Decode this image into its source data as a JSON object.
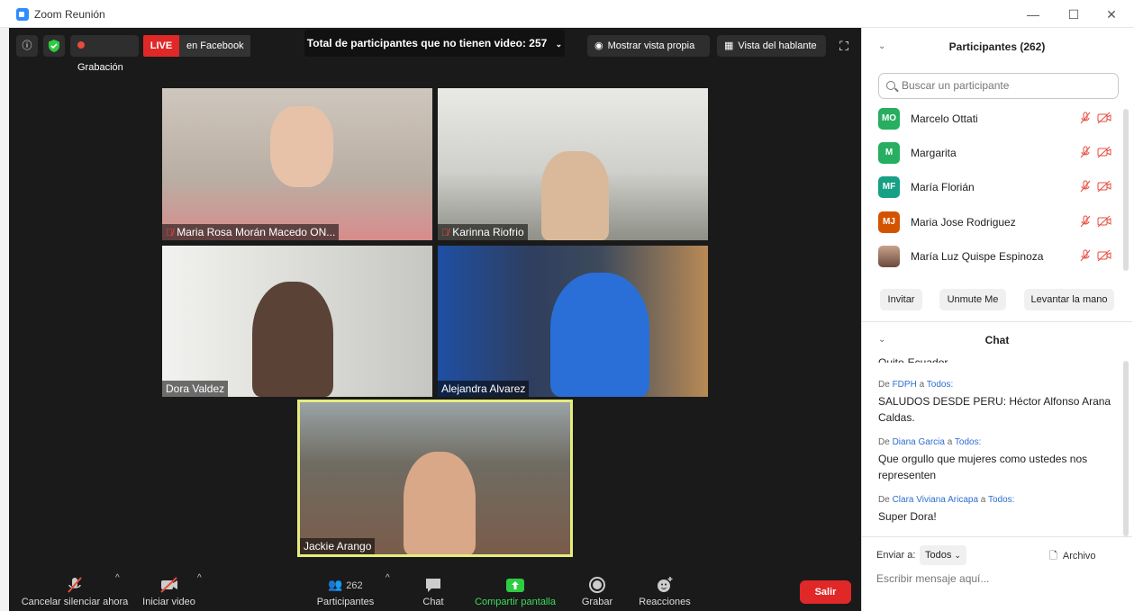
{
  "window": {
    "title": "Zoom Reunión"
  },
  "meeting_top": {
    "recording_label": "Grabación",
    "live_label": "LIVE",
    "facebook_label": "en Facebook",
    "total_no_video": "Total de participantes que no tienen video: 257",
    "show_self_view": "Mostrar vista propia",
    "speaker_view": "Vista del hablante"
  },
  "tiles": [
    {
      "name": "Maria Rosa Morán Macedo ON...",
      "muted": true
    },
    {
      "name": "Karinna Riofrio",
      "muted": true
    },
    {
      "name": "Dora Valdez",
      "muted": false
    },
    {
      "name": "Alejandra Alvarez",
      "muted": false
    },
    {
      "name": "Jackie Arango",
      "muted": false
    }
  ],
  "toolbar": {
    "unmute": "Cancelar silenciar ahora",
    "start_video": "Iniciar video",
    "participants": "Participantes",
    "participants_count": "262",
    "chat": "Chat",
    "share_screen": "Compartir pantalla",
    "record": "Grabar",
    "reactions": "Reacciones",
    "leave": "Salir"
  },
  "participants_panel": {
    "title": "Participantes (262)",
    "search_placeholder": "Buscar un participante",
    "list": [
      {
        "initials": "MO",
        "name": "Marcelo Ottati",
        "color": "#27ae60"
      },
      {
        "initials": "M",
        "name": "Margarita",
        "color": "#27ae60"
      },
      {
        "initials": "MF",
        "name": "María Florián",
        "color": "#16a085"
      },
      {
        "initials": "MJ",
        "name": "Maria Jose Rodriguez",
        "color": "#d35400"
      },
      {
        "initials": "",
        "name": "María Luz Quispe Espinoza",
        "color": "#a08070"
      }
    ],
    "invite": "Invitar",
    "unmute_me": "Unmute Me",
    "raise_hand": "Levantar la mano"
  },
  "chat_panel": {
    "title": "Chat",
    "partial_text": "Quito-Ecuador",
    "messages": [
      {
        "from_prefix": "De",
        "from": "FDPH",
        "to_prefix": "a",
        "to": "Todos:",
        "text": "SALUDOS DESDE PERU: Héctor Alfonso Arana Caldas."
      },
      {
        "from_prefix": "De",
        "from": "Diana Garcia",
        "to_prefix": "a",
        "to": "Todos:",
        "text": "Que orgullo que mujeres como ustedes nos representen"
      },
      {
        "from_prefix": "De",
        "from": "Clara Viviana Aricapa",
        "to_prefix": "a",
        "to": "Todos:",
        "text": "Super Dora!"
      }
    ],
    "send_to_label": "Enviar a:",
    "send_to_value": "Todos",
    "file_label": "Archivo",
    "input_placeholder": "Escribir mensaje aquí..."
  }
}
